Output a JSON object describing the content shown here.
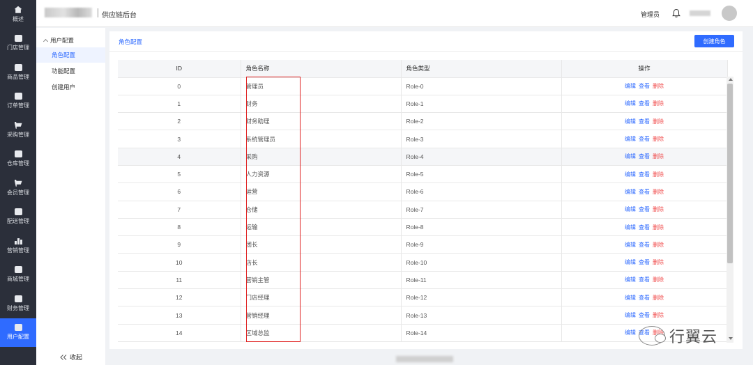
{
  "rail": {
    "items": [
      {
        "label": "概述",
        "icon": "home-icon"
      },
      {
        "label": "门店管理",
        "icon": "store-icon"
      },
      {
        "label": "商品管理",
        "icon": "product-icon"
      },
      {
        "label": "订单管理",
        "icon": "order-icon"
      },
      {
        "label": "采购管理",
        "icon": "cart-icon"
      },
      {
        "label": "仓库管理",
        "icon": "warehouse-icon"
      },
      {
        "label": "会员管理",
        "icon": "cart-icon"
      },
      {
        "label": "配送管理",
        "icon": "truck-icon"
      },
      {
        "label": "营销管理",
        "icon": "bar-chart-icon"
      },
      {
        "label": "商城管理",
        "icon": "shop-icon"
      },
      {
        "label": "财务管理",
        "icon": "money-bag-icon"
      },
      {
        "label": "用户配置",
        "icon": "shield-icon"
      }
    ],
    "active_index": 11
  },
  "header": {
    "title": "供应链后台",
    "user_role": "管理员"
  },
  "submenu": {
    "group_label": "用户配置",
    "items": [
      "角色配置",
      "功能配置",
      "创建用户"
    ],
    "active_index": 0,
    "collapse_label": "收起"
  },
  "panel": {
    "breadcrumb": "角色配置",
    "create_button": "创建角色"
  },
  "table": {
    "columns": [
      "ID",
      "角色名称",
      "角色类型",
      "操作"
    ],
    "actions": {
      "edit": "编辑",
      "view": "查看",
      "delete": "删除"
    },
    "rows": [
      {
        "id": "0",
        "name": "管理员",
        "type": "Role-0"
      },
      {
        "id": "1",
        "name": "财务",
        "type": "Role-1"
      },
      {
        "id": "2",
        "name": "财务助理",
        "type": "Role-2"
      },
      {
        "id": "3",
        "name": "系统管理员",
        "type": "Role-3"
      },
      {
        "id": "4",
        "name": "采购",
        "type": "Role-4"
      },
      {
        "id": "5",
        "name": "人力资源",
        "type": "Role-5"
      },
      {
        "id": "6",
        "name": "运营",
        "type": "Role-6"
      },
      {
        "id": "7",
        "name": "仓储",
        "type": "Role-7"
      },
      {
        "id": "8",
        "name": "运输",
        "type": "Role-8"
      },
      {
        "id": "9",
        "name": "团长",
        "type": "Role-9"
      },
      {
        "id": "10",
        "name": "店长",
        "type": "Role-10"
      },
      {
        "id": "11",
        "name": "营销主管",
        "type": "Role-11"
      },
      {
        "id": "12",
        "name": "门店经理",
        "type": "Role-12"
      },
      {
        "id": "13",
        "name": "营销经理",
        "type": "Role-13"
      },
      {
        "id": "14",
        "name": "区域总监",
        "type": "Role-14"
      }
    ],
    "highlight_row": 4
  },
  "watermark": {
    "text": "行翼云",
    "icon": "wechat-icon"
  },
  "colors": {
    "rail_bg": "#2b2f3a",
    "accent": "#2f6bff",
    "danger": "#f04848",
    "annotation_box": "#e02020"
  }
}
